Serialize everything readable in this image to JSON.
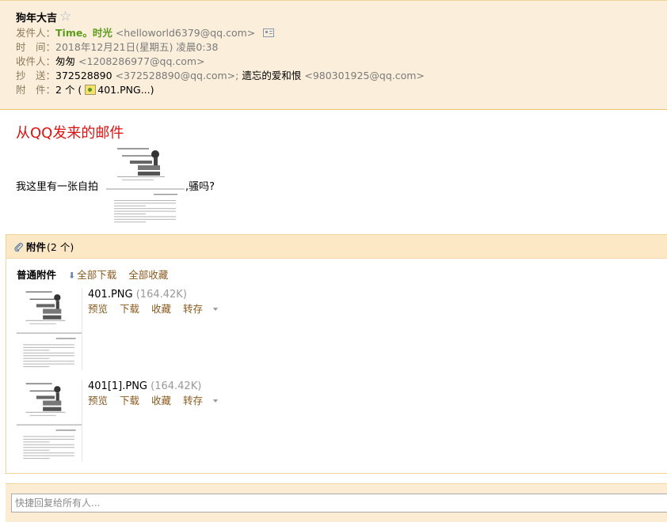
{
  "header": {
    "subject": "狗年大吉",
    "star_glyph": "☆",
    "from_label": "发件人：",
    "from_name": "Time。时光",
    "from_addr": "<helloworld6379@qq.com>",
    "time_label": "时　间：",
    "time_value": "2018年12月21日(星期五) 凌晨0:38",
    "to_label": "收件人：",
    "to_name": "匆匆",
    "to_addr": "<1208286977@qq.com>",
    "cc_label": "抄　送：",
    "cc_name1": "372528890",
    "cc_addr1": "<372528890@qq.com>;",
    "cc_name2": "遗忘的爱和恨",
    "cc_addr2": "<980301925@qq.com>",
    "att_label": "附　件：",
    "att_prefix": "2 个 (",
    "att_first": "401.PNG...)"
  },
  "body": {
    "title": "从QQ发来的邮件",
    "text_before": "我这里有一张自拍",
    "text_after": ",骚吗?"
  },
  "attachments": {
    "title": "附件",
    "count": "(2 个)",
    "normal_label": "普通附件",
    "download_all": "全部下载",
    "save_all": "全部收藏",
    "items": [
      {
        "name": "401.PNG",
        "size": "(164.42K)"
      },
      {
        "name": "401[1].PNG",
        "size": "(164.42K)"
      }
    ],
    "actions": {
      "preview": "预览",
      "download": "下载",
      "favorite": "收藏",
      "forward": "转存"
    }
  },
  "reply": {
    "placeholder": "快捷回复给所有人..."
  },
  "colors": {
    "header_bg": "#fbefdc",
    "sender": "#5d9c1b",
    "title_red": "#e11010",
    "link": "#8b5a1f"
  },
  "icons": [
    "star-icon",
    "vcard-icon",
    "image-file-icon",
    "paperclip-icon",
    "download-arrow-icon",
    "caret-down-icon"
  ]
}
